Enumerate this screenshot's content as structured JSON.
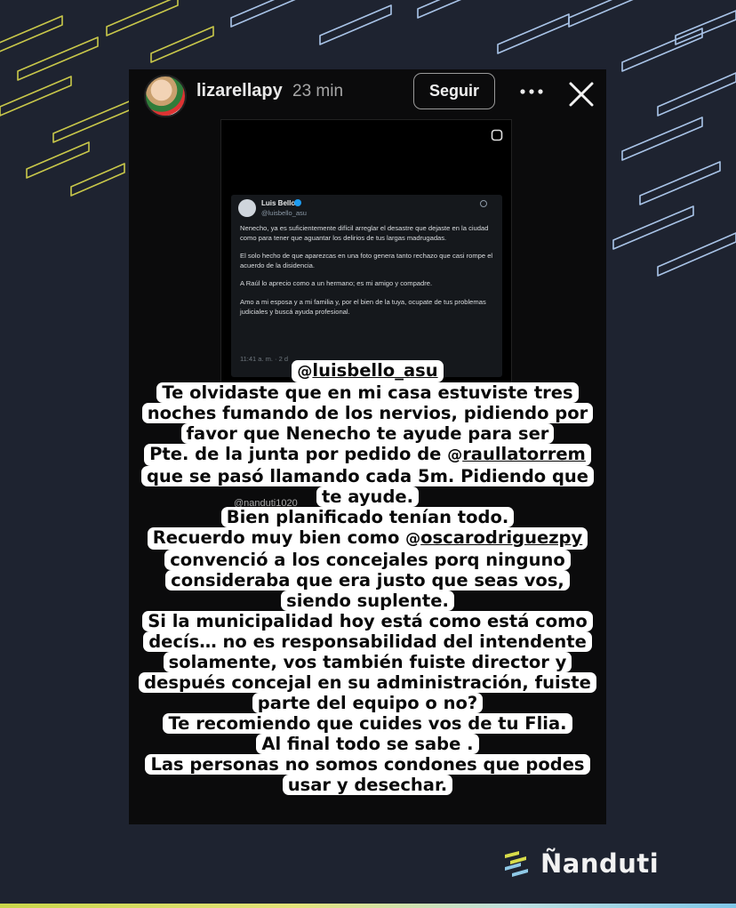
{
  "story": {
    "username": "lizarellapy",
    "time": "23 min",
    "follow_label": "Seguir",
    "icons": {
      "more": "more-icon",
      "close": "close-icon"
    }
  },
  "tweet": {
    "author_name": "Luis Bello",
    "author_handle": "@luisbello_asu",
    "paragraphs": [
      "Nenecho, ya es suficientemente difícil arreglar el desastre que dejaste en la ciudad como para tener que aguantar los delirios de tus largas madrugadas.",
      "El solo hecho de que aparezcas en una foto genera tanto rechazo que casi rompe el acuerdo de la disidencia.",
      "A Raúl lo aprecio como a un hermano; es mi amigo y compadre.",
      "Amo a mi esposa y a mi familia y, por el bien de la tuya, ocupate de tus problemas judiciales y buscá ayuda profesional."
    ],
    "meta": "11:41 a. m. · 2 d"
  },
  "watermark": "@nanduti1020",
  "overlay": {
    "mention1": "luisbello_asu",
    "line1": "Te olvidaste que en mi casa estuviste tres",
    "line2": "noches fumando de los nervios, pidiendo por",
    "line3": "favor que Nenecho te ayude para ser",
    "line4_prefix": "Pte. de la junta por pedido de ",
    "mention2": "raullatorrem",
    "line5": "que se pasó llamando cada 5m. Pidiendo que",
    "line6": "te ayude.",
    "line7": "Bien planificado tenían todo.",
    "line8_prefix": "Recuerdo muy bien como ",
    "mention3": "oscarodriguezpy",
    "line9": "convenció a los concejales porq ninguno",
    "line10": "consideraba que era justo que seas vos,",
    "line11": "siendo suplente.",
    "line12": "Si la municipalidad hoy está como está como",
    "line13": "decís… no es responsabilidad del intendente",
    "line14": "solamente, vos también fuiste director y",
    "line15": "después concejal en su administración, fuiste",
    "line16": "parte del equipo o no?",
    "line17": "Te recomiendo que cuides vos de tu Flia.",
    "line18": "Al final todo se sabe .",
    "line19": "Las personas no somos condones que podes",
    "line20": "usar y desechar."
  },
  "brand": {
    "name": "Ñanduti",
    "logo": "nanduti-logo"
  },
  "colors": {
    "background": "#1e2330",
    "pattern_yellow": "#c9c84a",
    "pattern_blue": "#a9c4e8",
    "story_bg": "#0b0b0c"
  }
}
